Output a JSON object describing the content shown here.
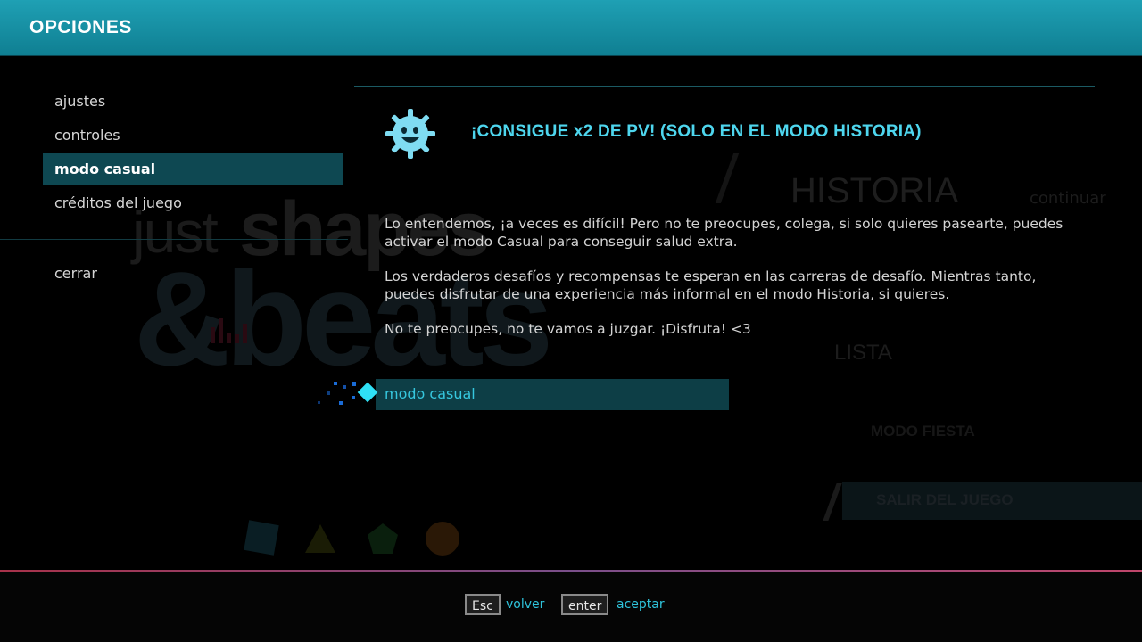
{
  "header": {
    "title": "OPCIONES"
  },
  "sidebar": {
    "items": [
      {
        "label": "ajustes"
      },
      {
        "label": "controles"
      },
      {
        "label": "modo casual",
        "active": true
      },
      {
        "label": "créditos del juego"
      }
    ],
    "close_label": "cerrar"
  },
  "panel": {
    "icon": "smiling-gear-mascot-icon",
    "title": "¡CONSIGUE x2 DE PV! (SOLO EN EL MODO HISTORIA)",
    "paragraphs": [
      "Lo entendemos, ¡a veces es difícil! Pero no te preocupes, colega, si solo quieres pasearte, puedes activar el modo Casual para conseguir salud extra.",
      "Los verdaderos desafíos y recompensas te esperan en las carreras de desafío. Mientras tanto, puedes disfrutar de una experiencia más informal en el modo Historia, si quieres.",
      "No te preocupes, no te vamos a juzgar. ¡Disfruta! <3"
    ],
    "toggle_label": "modo casual"
  },
  "background_menu": {
    "logo_just": "just",
    "logo_shapes": "shapes",
    "logo_beats": "&beats",
    "historia": "HISTORIA",
    "continuar": "continuar",
    "lista": "LISTA",
    "modo_fiesta": "MODO FIESTA",
    "salir": "SALIR DEL JUEGO"
  },
  "footer": {
    "back_key": "Esc",
    "back_label": "volver",
    "accept_key": "enter",
    "accept_label": "aceptar"
  },
  "colors": {
    "header": "#1fa0b4",
    "accent": "#4ed6ee",
    "active_row": "#0e4852",
    "cursor": "#2fe0f5"
  }
}
